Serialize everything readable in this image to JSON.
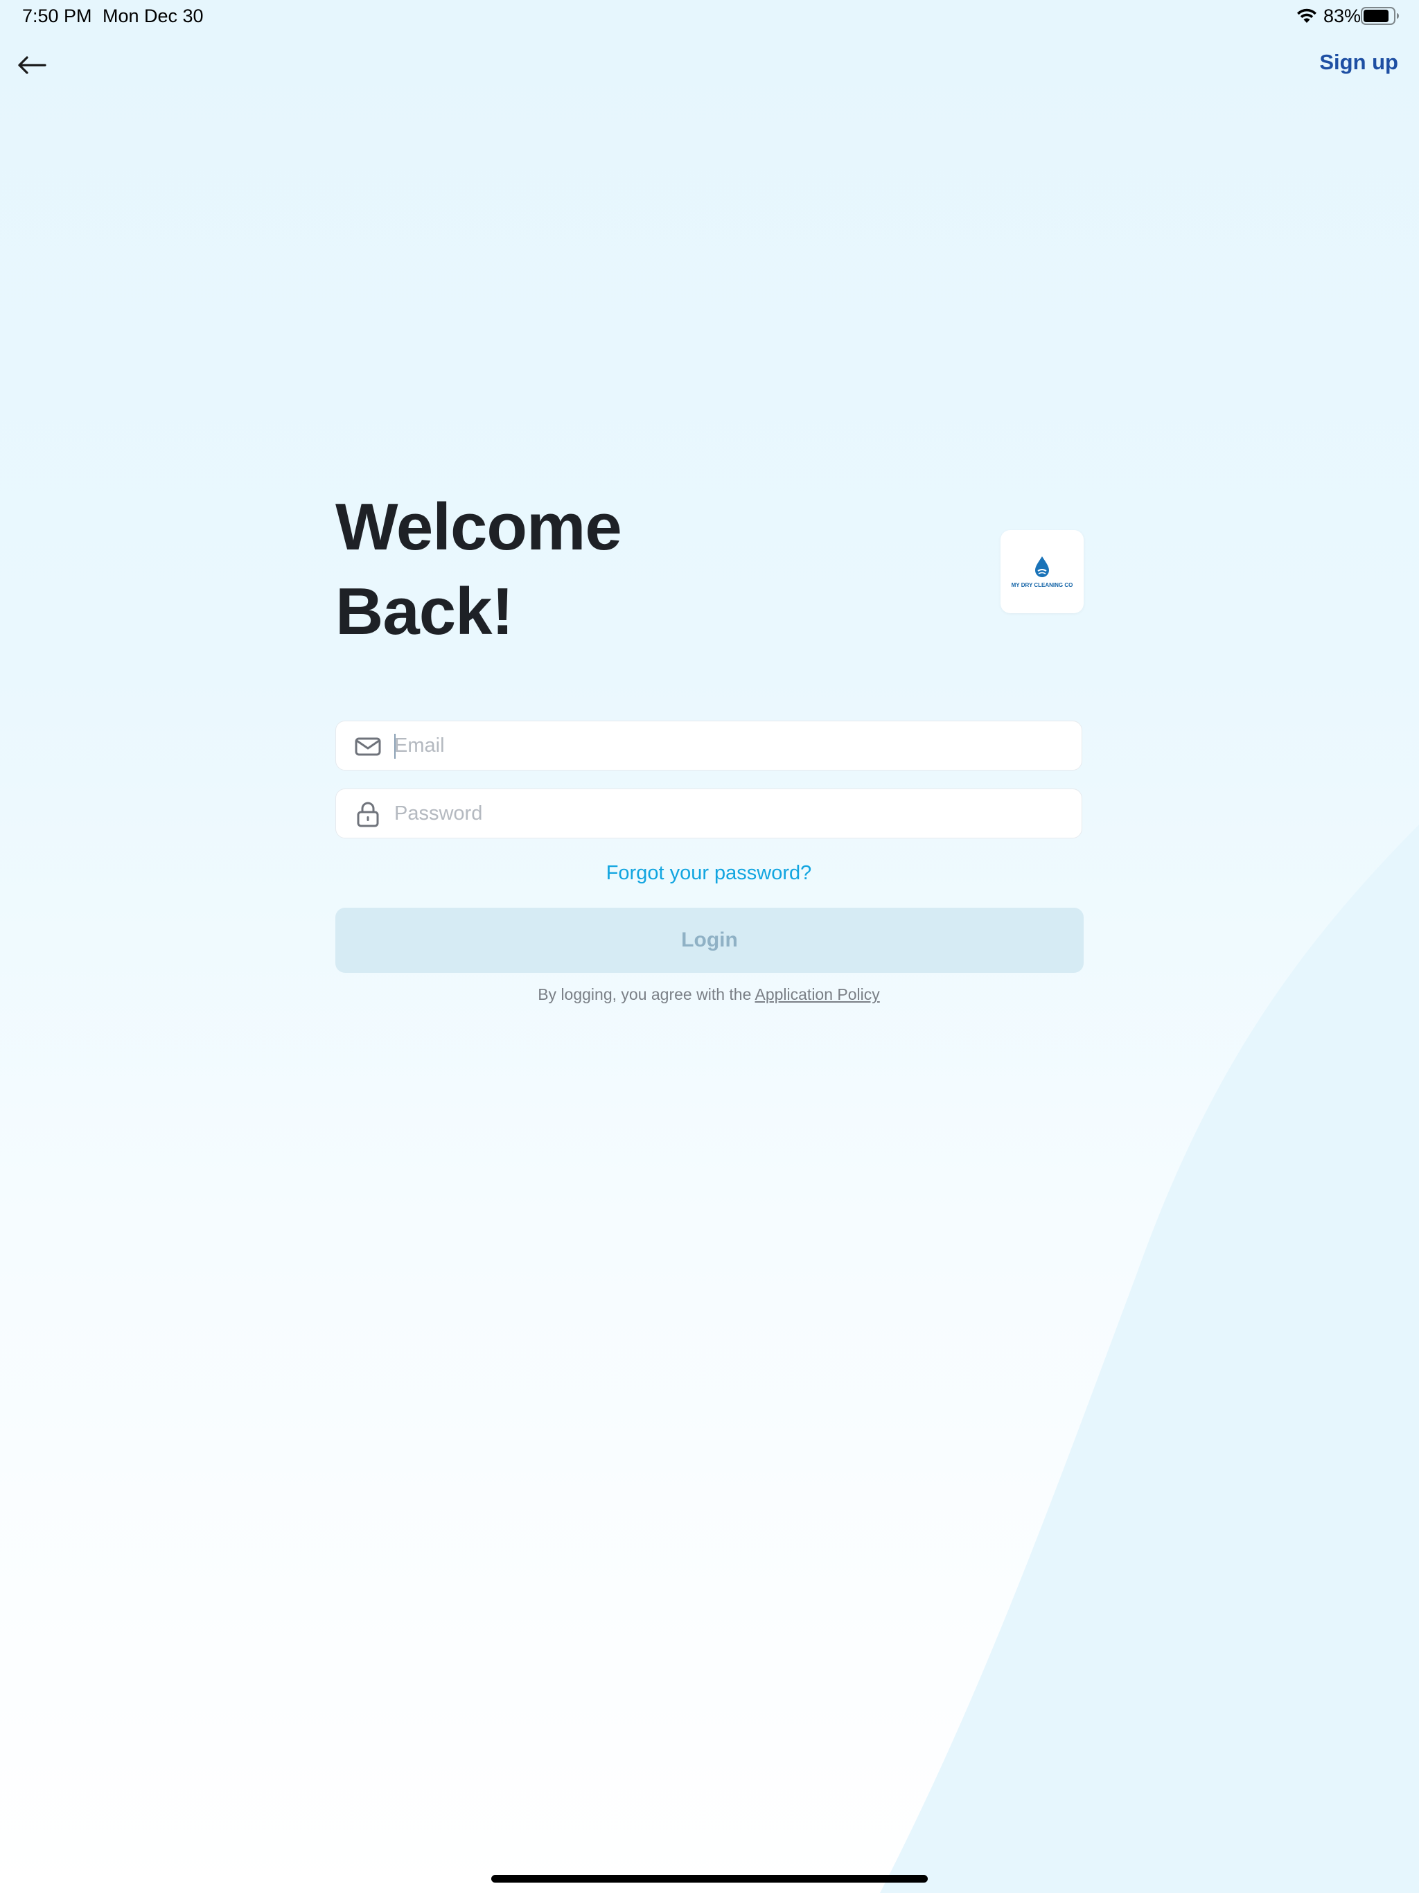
{
  "status_bar": {
    "time": "7:50 PM",
    "date": "Mon Dec 30",
    "battery": "83%"
  },
  "nav": {
    "back_icon": "arrow-left-icon",
    "signup_label": "Sign up"
  },
  "header": {
    "title_line1": "Welcome",
    "title_line2": "Back!"
  },
  "logo": {
    "text": "MY DRY CLEANING CO"
  },
  "form": {
    "email": {
      "placeholder": "Email",
      "value": "",
      "icon": "mail-icon"
    },
    "password": {
      "placeholder": "Password",
      "value": "",
      "icon": "lock-icon"
    },
    "forgot_label": "Forgot your password?",
    "login_label": "Login"
  },
  "policy": {
    "prefix": "By logging, you agree with the",
    "link_label": "Application Policy"
  },
  "colors": {
    "accent": "#12a5e0",
    "link_blue": "#1e4fa3",
    "title": "#1e2126",
    "login_bg": "#d6ebf4",
    "login_text": "#8fb1c5"
  }
}
